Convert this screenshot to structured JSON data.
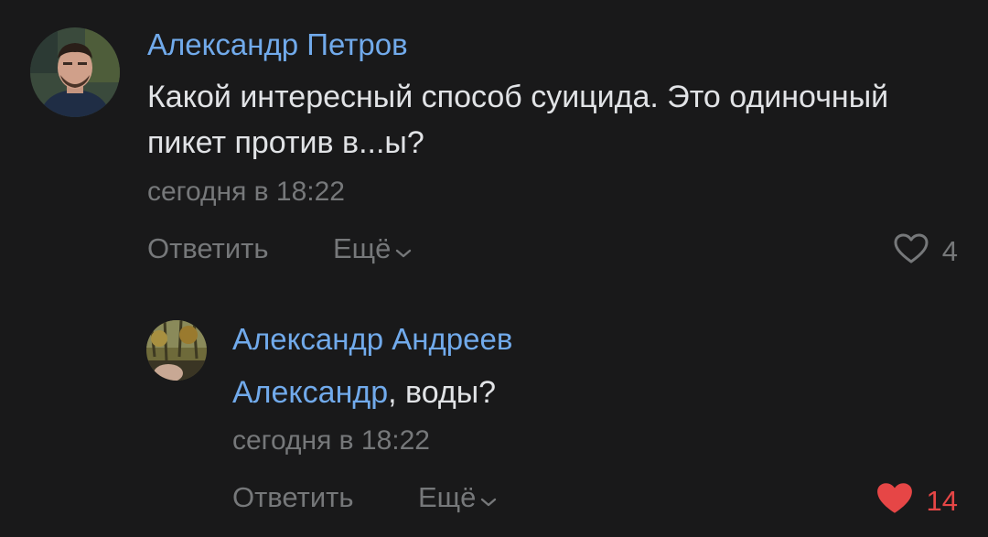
{
  "colors": {
    "background": "#19191a",
    "author": "#71aaeb",
    "text": "#e1e3e6",
    "secondary": "#76787a",
    "liked": "#e64646"
  },
  "comments": [
    {
      "author": "Александр Петров",
      "text": "Какой интересный способ суицида. Это одиночный пикет против в...ы?",
      "time": "сегодня в 18:22",
      "reply_label": "Ответить",
      "more_label": "Ещё",
      "more_icon": "chevron-down-icon",
      "like_icon": "heart-outline-icon",
      "likes": "4",
      "liked": false
    },
    {
      "author": "Александр Андреев",
      "mention": "Александр",
      "text": ", воды?",
      "time": "сегодня в 18:22",
      "reply_label": "Ответить",
      "more_label": "Ещё",
      "more_icon": "chevron-down-icon",
      "like_icon": "heart-filled-icon",
      "likes": "14",
      "liked": true
    }
  ]
}
